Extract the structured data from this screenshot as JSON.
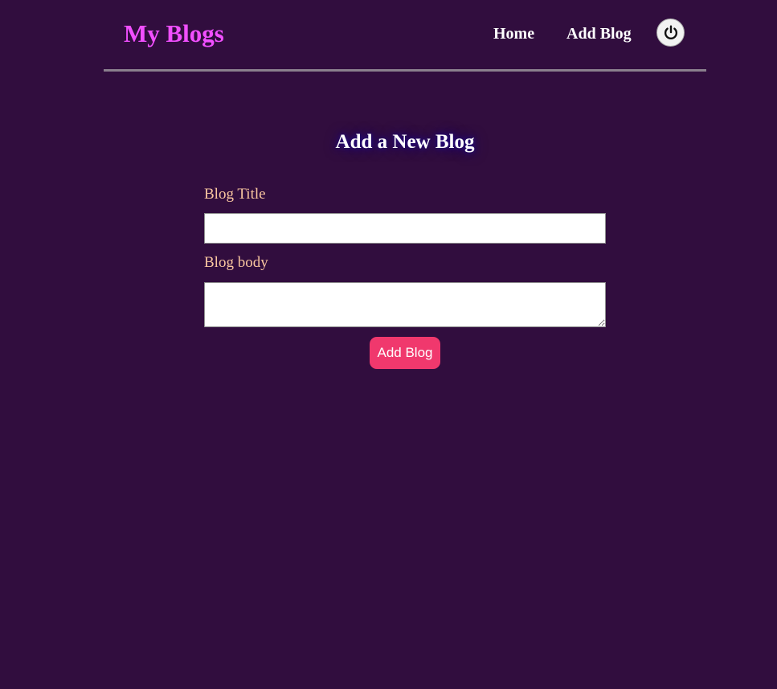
{
  "header": {
    "brand": "My Blogs",
    "nav": {
      "home_label": "Home",
      "add_blog_label": "Add Blog"
    },
    "power_icon": "power-icon"
  },
  "form": {
    "title": "Add a New Blog",
    "title_field": {
      "label": "Blog Title",
      "value": "",
      "placeholder": ""
    },
    "body_field": {
      "label": "Blog body",
      "value": "",
      "placeholder": ""
    },
    "submit_label": "Add Blog"
  },
  "colors": {
    "background": "#310d3e",
    "brand": "#f14fff",
    "label": "#f9c6a0",
    "accent_button": "#f0386d",
    "divider": "#8a7f8d"
  }
}
